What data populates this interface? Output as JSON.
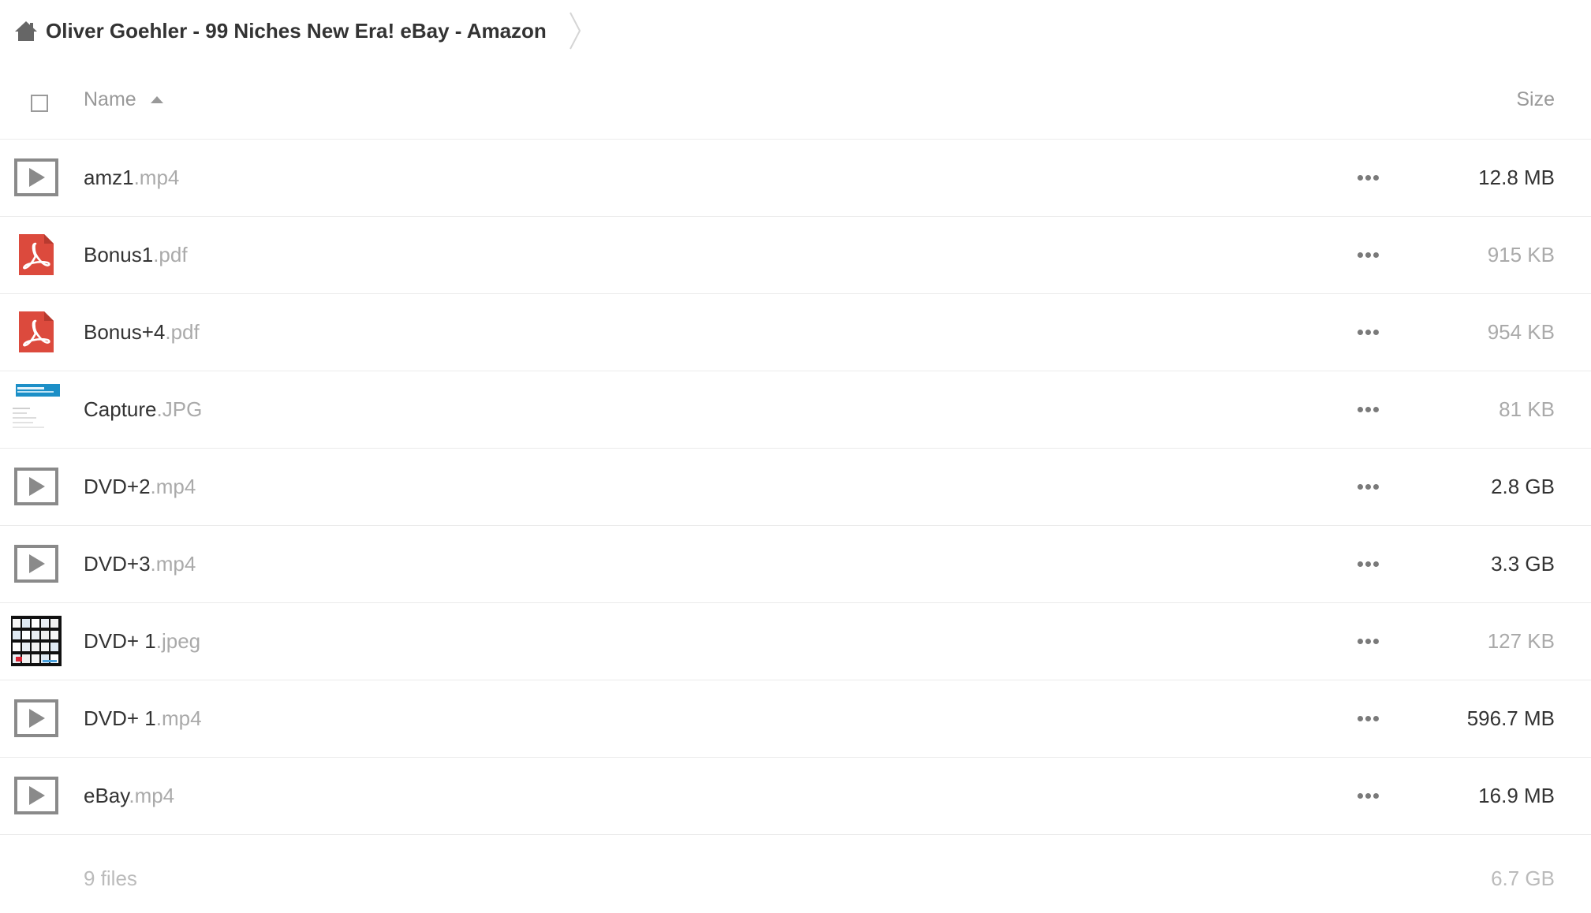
{
  "breadcrumb": {
    "home_icon": "home-icon",
    "label": "Oliver Goehler - 99 Niches New Era! eBay - Amazon"
  },
  "header": {
    "name_label": "Name",
    "size_label": "Size",
    "sort": "ascending"
  },
  "files": [
    {
      "base": "amz1",
      "ext": ".mp4",
      "size": "12.8 MB",
      "icon": "video-icon",
      "size_color": "#333333"
    },
    {
      "base": "Bonus1",
      "ext": ".pdf",
      "size": "915 KB",
      "icon": "pdf-icon",
      "size_color": "#aaaaaa"
    },
    {
      "base": "Bonus+4",
      "ext": ".pdf",
      "size": "954 KB",
      "icon": "pdf-icon",
      "size_color": "#aaaaaa"
    },
    {
      "base": "Capture",
      "ext": ".JPG",
      "size": "81 KB",
      "icon": "image-thumbnail",
      "size_color": "#aaaaaa"
    },
    {
      "base": "DVD+2",
      "ext": ".mp4",
      "size": "2.8 GB",
      "icon": "video-icon",
      "size_color": "#333333"
    },
    {
      "base": "DVD+3",
      "ext": ".mp4",
      "size": "3.3 GB",
      "icon": "video-icon",
      "size_color": "#333333"
    },
    {
      "base": "DVD+ 1",
      "ext": ".jpeg",
      "size": "127 KB",
      "icon": "image-thumbnail",
      "size_color": "#aaaaaa"
    },
    {
      "base": "DVD+ 1",
      "ext": ".mp4",
      "size": "596.7 MB",
      "icon": "video-icon",
      "size_color": "#333333"
    },
    {
      "base": "eBay",
      "ext": ".mp4",
      "size": "16.9 MB",
      "icon": "video-icon",
      "size_color": "#333333"
    }
  ],
  "summary": {
    "count": "9 files",
    "total_size": "6.7 GB"
  },
  "colors": {
    "pdf_red": "#dc4a3d",
    "icon_gray": "#8a8a8a"
  }
}
